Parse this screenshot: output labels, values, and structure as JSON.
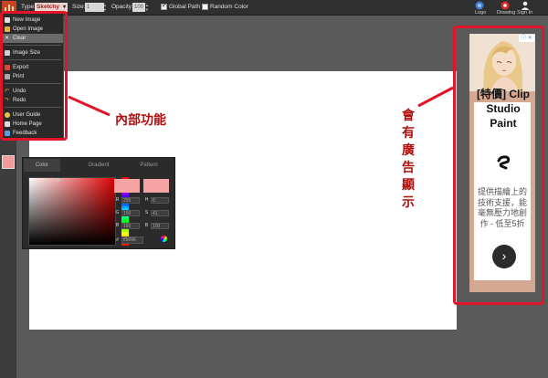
{
  "toolbar": {
    "type_label": "Type:",
    "type_value": "Sketchy",
    "size_label": "Size:",
    "size_value": "1",
    "opacity_label": "Opacity:",
    "opacity_value": "100",
    "global_path_label": "Global Path",
    "global_path_checked": true,
    "random_color_label": "Random Color",
    "random_color_checked": false,
    "logo_label": "Logo",
    "drawing_label": "Drawing",
    "signin_label": "Sign In"
  },
  "menu": {
    "items": [
      {
        "label": "New Image",
        "icon": "new-image-icon"
      },
      {
        "label": "Open Image",
        "icon": "open-image-icon"
      },
      {
        "label": "Clear",
        "icon": "clear-icon",
        "active": true
      },
      {
        "label": "Image Size",
        "icon": "image-size-icon"
      },
      {
        "label": "Export",
        "icon": "export-icon"
      },
      {
        "label": "Print",
        "icon": "print-icon"
      },
      {
        "label": "Undo",
        "icon": "undo-icon"
      },
      {
        "label": "Redo",
        "icon": "redo-icon"
      },
      {
        "label": "User Guide",
        "icon": "user-guide-icon"
      },
      {
        "label": "Home Page",
        "icon": "home-page-icon"
      },
      {
        "label": "Feedback",
        "icon": "feedback-icon"
      }
    ]
  },
  "color_picker": {
    "tabs": [
      "Color",
      "Gradient",
      "Pattern"
    ],
    "active_tab": "Color",
    "channels_left": [
      {
        "key": "R",
        "value": "255"
      },
      {
        "key": "G",
        "value": "150"
      },
      {
        "key": "B",
        "value": "150"
      }
    ],
    "channels_right": [
      {
        "key": "H",
        "value": "0"
      },
      {
        "key": "S",
        "value": "41"
      },
      {
        "key": "B",
        "value": "100"
      }
    ],
    "hex_key": "#",
    "hex_value": "ff9696",
    "preview_color": "#f5a3a3",
    "swatch_color": "#f19c9c"
  },
  "annotations": {
    "internal_functions": "內部功能",
    "ad_notice_chars": [
      "會",
      "有",
      "廣",
      "告",
      "顯",
      "示"
    ]
  },
  "ad": {
    "badge": "ⓘ ✕",
    "headline_line1": "[特價] Clip",
    "headline_line2": "Studio",
    "headline_line3": "Paint",
    "body": "提供描繪上的技術支援，能毫無壓力地創作 - 低至5折",
    "cta": "›"
  },
  "colors": {
    "annotation_red": "#e2142a",
    "annotation_text": "#b01010",
    "toolbar_bg": "#2f2f2f",
    "workspace_bg": "#5a5a5a"
  }
}
